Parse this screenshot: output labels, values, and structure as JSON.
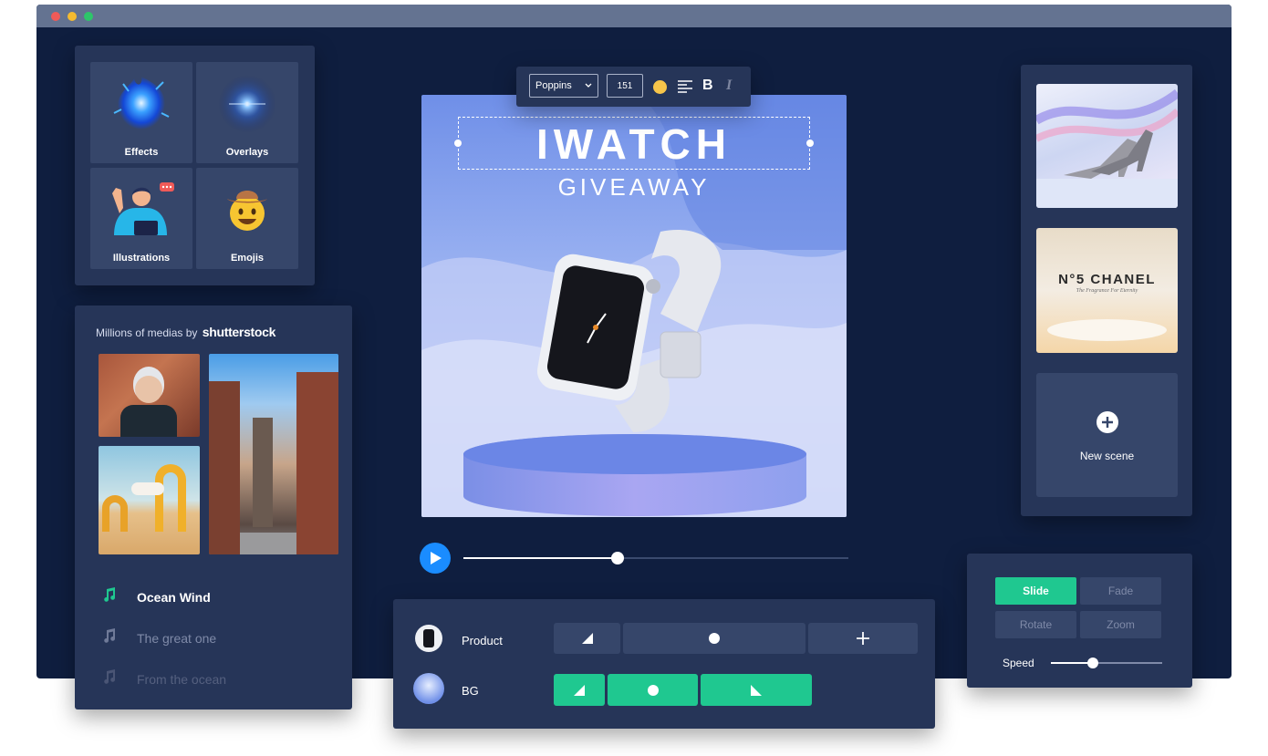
{
  "colors": {
    "accent": "#1fc890",
    "window": "#0f1e3f",
    "panel": "#263558",
    "tile": "#36466a",
    "play": "#1a8cff"
  },
  "assets": {
    "tiles": [
      {
        "label": "Effects",
        "icon": "blue-fire-icon"
      },
      {
        "label": "Overlays",
        "icon": "light-flare-icon"
      },
      {
        "label": "Illustrations",
        "icon": "waving-person-icon"
      },
      {
        "label": "Emojis",
        "icon": "cowboy-emoji-icon"
      }
    ]
  },
  "media": {
    "caption": "Millions of medias by",
    "brand": "shutterstock",
    "tracks": [
      {
        "title": "Ocean Wind",
        "active": true
      },
      {
        "title": "The great one",
        "active": false
      },
      {
        "title": "From the ocean",
        "active": false
      }
    ]
  },
  "toolbar": {
    "font": "Poppins",
    "size": "151",
    "bold": "B",
    "italic": "I"
  },
  "canvas": {
    "title": "IWATCH",
    "subtitle": "GIVEAWAY"
  },
  "player": {
    "progress": 0.4
  },
  "scenes": {
    "items": [
      {
        "name": "heels-scene"
      },
      {
        "name": "chanel-scene",
        "title": "N°5 CHANEL",
        "subtitle": "The Fragrance For Eternity"
      }
    ],
    "new_label": "New scene"
  },
  "layers": [
    {
      "label": "Product"
    },
    {
      "label": "BG"
    }
  ],
  "transitions": {
    "options": [
      "Slide",
      "Fade",
      "Rotate",
      "Zoom"
    ],
    "selected": "Slide",
    "speed_label": "Speed",
    "speed": 0.38
  }
}
